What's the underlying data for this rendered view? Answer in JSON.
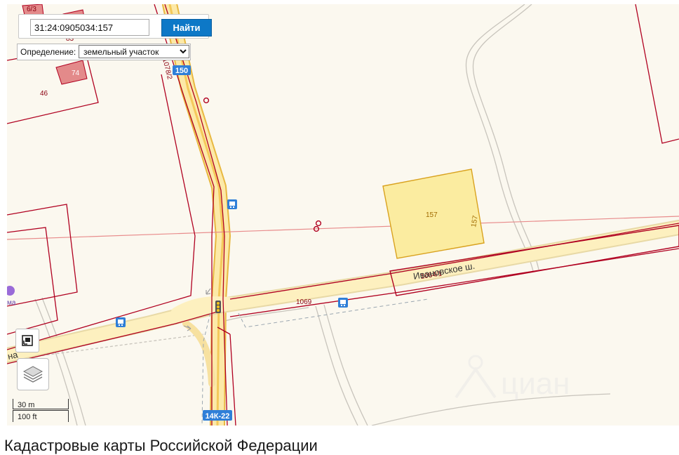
{
  "search": {
    "value": "31:24:0905034:157",
    "button_label": "Найти"
  },
  "definition": {
    "label": "Определение:",
    "selected": "земельный участок"
  },
  "scale": {
    "metric": "30 m",
    "imperial": "100 ft"
  },
  "parcels": {
    "selected": "157",
    "selected_side": "157",
    "strip": "1064/1",
    "road": "1069",
    "top_left_1": "83",
    "top_left_2": "74",
    "top_left_3": "46",
    "top_edge": "6/3",
    "vertical_road": "1078/2"
  },
  "roads": {
    "street_name": "Ивановское ш.",
    "route_badge_top": "150",
    "route_badge_bottom": "14К-22",
    "left_edge_label": "на",
    "poi_label": "ма"
  },
  "watermark": "циан",
  "page_heading": "Кадастровые карты Российской Федерации",
  "colors": {
    "map_background": "#fbf8ef",
    "parcel_border": "#b00020",
    "selected_fill": "#fbeca0",
    "road_fill": "#fce9a8",
    "button": "#0d78c7",
    "route_badge": "#2f7fd8"
  },
  "icons": {
    "bus_stop": "bus-stop-icon",
    "traffic_light": "traffic-light-icon",
    "layers": "layers-icon",
    "fullscreen": "fullscreen-icon",
    "poi": "poi-icon"
  }
}
